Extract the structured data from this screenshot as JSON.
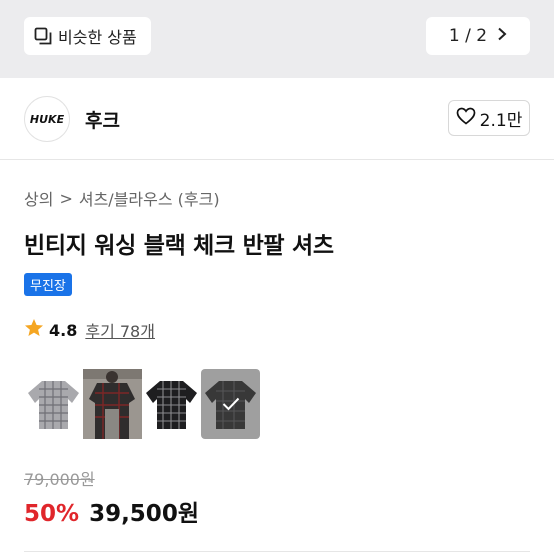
{
  "header": {
    "similar_label": "비슷한 상품",
    "pager": "1 / 2"
  },
  "brand": {
    "logo_text": "HUKE",
    "name": "후크",
    "likes": "2.1만"
  },
  "breadcrumb": {
    "category": "상의",
    "separator": ">",
    "subcategory": "셔츠/블라우스 (후크)"
  },
  "product": {
    "title": "빈티지 워싱 블랙 체크 반팔 셔츠",
    "badge": "무진장",
    "rating": "4.8",
    "reviews": "후기 78개",
    "original_price": "79,000원",
    "discount": "50%",
    "price": "39,500원"
  },
  "thumbnails": [
    {
      "name": "gray-check-shirt",
      "selected": false
    },
    {
      "name": "model-black-check-shirt",
      "selected": false
    },
    {
      "name": "black-check-shirt",
      "selected": false
    },
    {
      "name": "black-check-shirt-dark",
      "selected": true
    }
  ],
  "colors": {
    "accent_blue": "#1a73e8",
    "discount_red": "#e0262b",
    "star": "#f5a623"
  }
}
